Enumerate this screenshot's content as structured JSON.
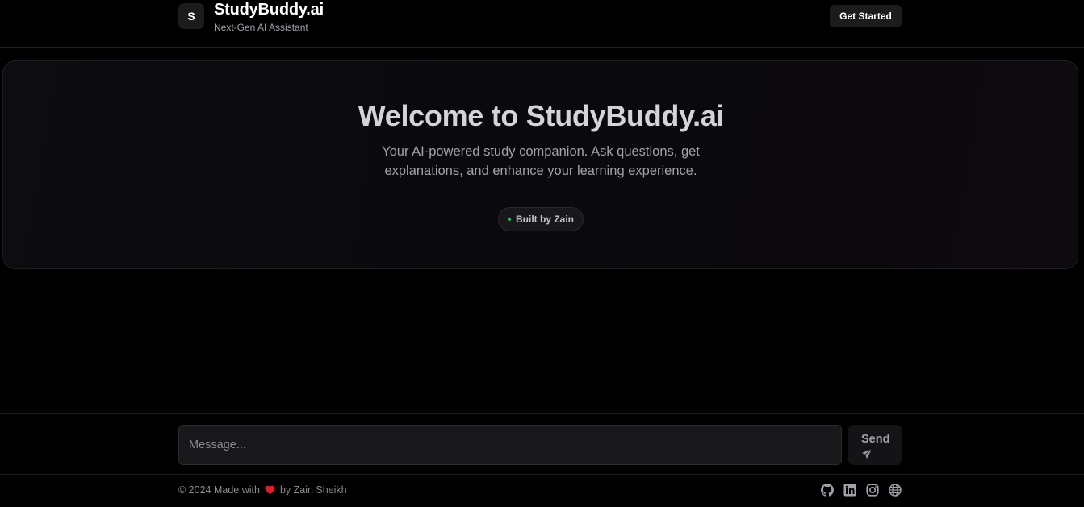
{
  "header": {
    "logo_letter": "S",
    "brand_title": "StudyBuddy.ai",
    "brand_subtitle": "Next-Gen AI Assistant",
    "cta_label": "Get Started"
  },
  "hero": {
    "title": "Welcome to StudyBuddy.ai",
    "description": "Your AI-powered study companion. Ask questions, get explanations, and enhance your learning experience.",
    "badge_label": "Built by Zain",
    "badge_dot_color": "#22c55e"
  },
  "composer": {
    "placeholder": "Message...",
    "value": "",
    "send_label": "Send",
    "send_icon": "paper-plane-icon"
  },
  "footer": {
    "copyright_prefix": "© 2024 Made with",
    "heart_icon": "heart-icon",
    "heart_color": "#e11d2a",
    "copyright_suffix": "by Zain Sheikh",
    "social_links": [
      "github-icon",
      "linkedin-icon",
      "instagram-icon",
      "globe-icon"
    ]
  },
  "colors": {
    "background": "#000000",
    "surface": "#18181b",
    "text_primary": "#ffffff",
    "text_muted": "#a1a1aa"
  }
}
